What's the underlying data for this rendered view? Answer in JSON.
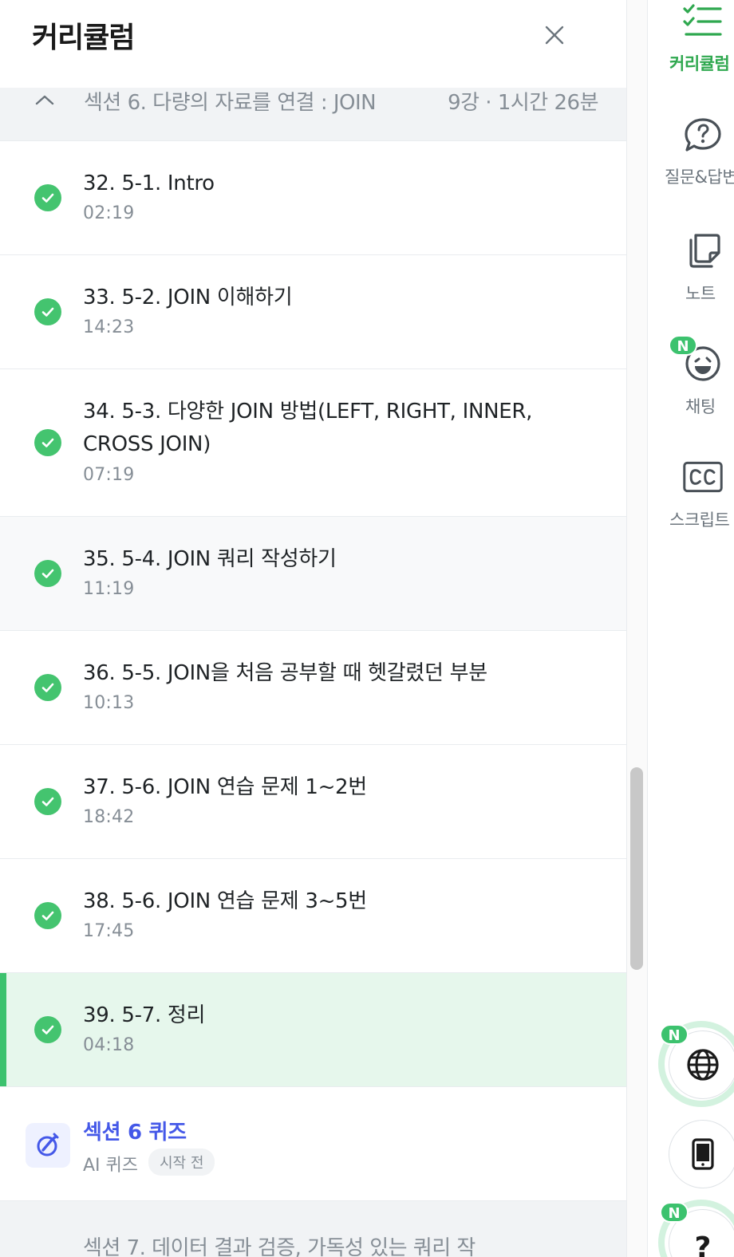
{
  "panel": {
    "title": "커리큘럼",
    "section": {
      "title": "섹션 6. 다량의 자료를 연결 : JOIN",
      "meta": "9강 · 1시간 26분"
    },
    "lessons": [
      {
        "title": "32. 5-1. Intro",
        "duration": "02:19",
        "state": "done"
      },
      {
        "title": "33. 5-2. JOIN 이해하기",
        "duration": "14:23",
        "state": "done"
      },
      {
        "title": "34. 5-3. 다양한 JOIN 방법(LEFT, RIGHT, INNER, CROSS JOIN)",
        "duration": "07:19",
        "state": "done"
      },
      {
        "title": "35. 5-4. JOIN 쿼리 작성하기",
        "duration": "11:19",
        "state": "done"
      },
      {
        "title": "36. 5-5. JOIN을 처음 공부할 때 헷갈렸던 부분",
        "duration": "10:13",
        "state": "done"
      },
      {
        "title": "37. 5-6. JOIN 연습 문제 1~2번",
        "duration": "18:42",
        "state": "done"
      },
      {
        "title": "38. 5-6. JOIN 연습 문제 3~5번",
        "duration": "17:45",
        "state": "done"
      },
      {
        "title": "39. 5-7. 정리",
        "duration": "04:18",
        "state": "done"
      }
    ],
    "quiz": {
      "title": "섹션 6 퀴즈",
      "subtitle": "AI 퀴즈",
      "badge": "시작 전"
    },
    "next_section": {
      "title": "섹션 7. 데이터 결과 검증, 가독성 있는 쿼리 작"
    }
  },
  "rail": {
    "items": [
      {
        "label": "커리큘럼",
        "icon": "curriculum-list-icon",
        "active": true
      },
      {
        "label": "질문&답변",
        "icon": "question-bubble-icon",
        "active": false
      },
      {
        "label": "노트",
        "icon": "note-icon",
        "active": false
      },
      {
        "label": "채팅",
        "icon": "chat-smile-icon",
        "active": false,
        "badge": "N"
      },
      {
        "label": "스크립트",
        "icon": "cc-icon",
        "active": false
      }
    ],
    "globe_badge": "N",
    "help_badge": "N",
    "help_label": "?"
  },
  "colors": {
    "accent_green": "#3cc26e",
    "quiz_blue": "#4458e8",
    "active_row": "#e6f7ec"
  }
}
